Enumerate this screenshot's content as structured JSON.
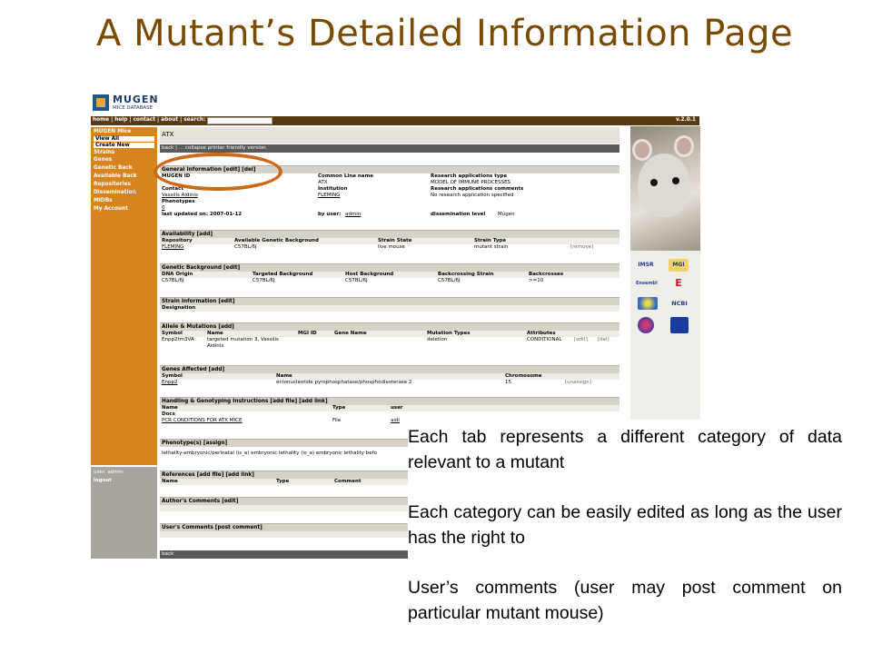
{
  "slide_title": "A Mutant’s Detailed Information Page",
  "app": {
    "logo_name": "MUGEN",
    "logo_sub": "MICE DATABASE",
    "nav_links": "home | help | contact | about | search:",
    "version": "v.2.0.1"
  },
  "sidebar": {
    "items": [
      "MUGEN Mice",
      "View All",
      "Create New",
      "Strains",
      "Genes",
      "Genetic Back",
      "Available Back",
      "Repositories",
      "Dissemination",
      "MIDBs",
      "My Account"
    ],
    "user_label": "user: admin",
    "logout": "logout"
  },
  "page": {
    "title": "ATX",
    "backbar": "back  |  ...  collapse   printer friendly version",
    "footer_back": "back"
  },
  "general": {
    "header": "General Information  [edit]  [del]",
    "mugen_id_label": "MUGEN ID",
    "common_line_label": "Common Line name",
    "common_line_value": "ATX",
    "research_type_label": "Research applications type",
    "research_type_value": "MODEL OF IMMUNE PROCESSES",
    "contact_label": "Contact",
    "contact_value": "Vassilis Aidinis",
    "institution_label": "Institution",
    "institution_value": "FLEMING",
    "research_comments_label": "Research applications comments",
    "research_comments_value": "No research application specified",
    "phenotypes_label": "Phenotypes",
    "phenotypes_value": "0",
    "last_updated": "last updated on: 2007-01-12",
    "by_user_label": "by user:",
    "by_user_value": "admin",
    "dissemination_label": "dissemination level",
    "dissemination_value": "Mugen"
  },
  "availability": {
    "header": "Availability  [add]",
    "columns": [
      "Repository",
      "Available Genetic Background",
      "Strain State",
      "Strain Type"
    ],
    "row": [
      "FLEMING",
      "C57BL/6J",
      "live mouse",
      "mutant strain",
      "[remove]"
    ]
  },
  "genetic_background": {
    "header": "Genetic Background  [edit]",
    "columns": [
      "DNA Origin",
      "Targeted Background",
      "Host Background",
      "Backcrossing Strain",
      "Backcrosses"
    ],
    "row": [
      "C57BL/6J",
      "C57BL/6J",
      "C57BL/6J",
      "C57BL/6J",
      ">=10"
    ]
  },
  "strain_info": {
    "header": "Strain Information  [edit]",
    "row": "Designation"
  },
  "allele": {
    "header": "Allele & Mutations  [add]",
    "columns": [
      "Symbol",
      "Name",
      "MGI ID",
      "Gene Name",
      "Mutation Types",
      "Attributes"
    ],
    "symbol": "Enpp2tm3VA",
    "name": "targeted mutation 3, Vassilis",
    "name2": "Aidinis",
    "mutation": "deletion",
    "attributes": "CONDITIONAL",
    "edit": "[edit]",
    "del": "[del]"
  },
  "genes": {
    "header": "Genes Affected  [add]",
    "columns": [
      "Symbol",
      "Name",
      "Chromosome"
    ],
    "row": [
      "Enpp2",
      "ectonucleotide pyrophosphatase/phosphodiesterase 2",
      "15",
      "[unassign]"
    ]
  },
  "handling": {
    "header": "Handling & Genotyping Instructions  [add file]  [add link]",
    "columns": [
      "Name",
      "Type",
      "user"
    ],
    "docs": "Docs",
    "row": [
      "PCR CONDITIONS FOR ATX MICE",
      "File",
      "aidi"
    ]
  },
  "phenotype": {
    "header": "Phenotype(s)  [assign]",
    "row": "lethality-embryonic/perinatal (is_a) embryonic lethality (is_a) embryonic lethality befo"
  },
  "references": {
    "header": "References  [add file]  [add link]",
    "columns": [
      "Name",
      "Type",
      "Comment"
    ]
  },
  "authors_comments": {
    "header": "Author's Comments  [edit]"
  },
  "users_comments": {
    "header": "User's Comments  [post comment]"
  },
  "logos": [
    "IMSR",
    "MGI",
    "Ensembl",
    "E",
    "",
    "NCBI",
    "",
    ""
  ],
  "caption": {
    "p1": "Each tab represents a different category of data relevant to a mutant",
    "p2": "Each category can be easily edited as long as the user has the right to",
    "p3": "User’s comments (user may post comment on particular mutant mouse)"
  },
  "colors": {
    "title": "#7a4a00",
    "sidebar": "#d8841e",
    "topnav": "#5a3a14",
    "highlight": "#cc6a18"
  }
}
